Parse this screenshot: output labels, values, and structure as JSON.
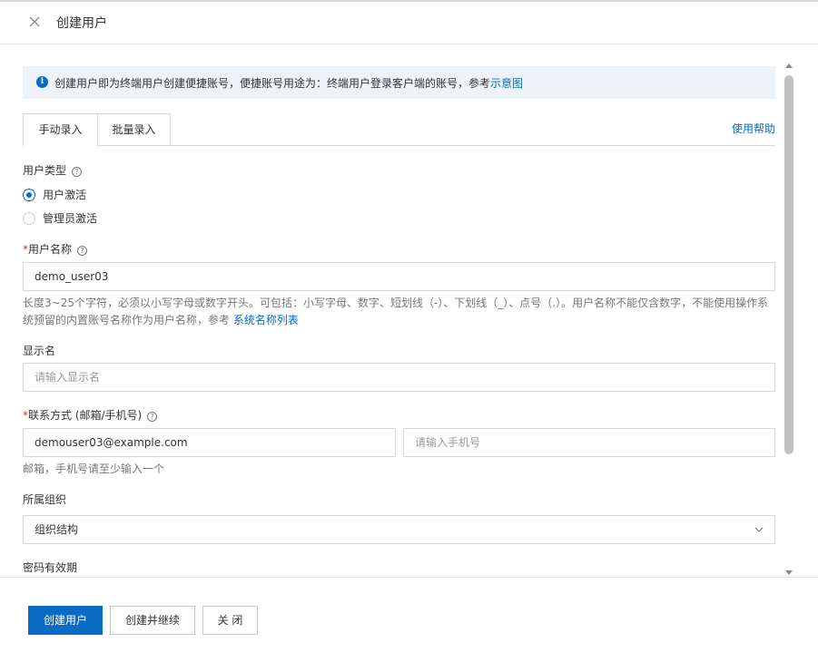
{
  "dialog": {
    "title": "创建用户"
  },
  "notice": {
    "text": "创建用户即为终端用户创建便捷账号，便捷账号用途为：终端用户登录客户端的账号，参考",
    "link": "示意图"
  },
  "tabs": [
    {
      "label": "手动录入"
    },
    {
      "label": "批量录入"
    }
  ],
  "help_link": "使用帮助",
  "user_type": {
    "label": "用户类型",
    "options": [
      {
        "label": "用户激活",
        "selected": true
      },
      {
        "label": "管理员激活",
        "selected": false
      }
    ]
  },
  "username": {
    "required_mark": "*",
    "label": "用户名称",
    "value": "demo_user03",
    "hint": "长度3~25个字符，必须以小写字母或数字开头。可包括：小写字母、数字、短划线（-）、下划线（_）、点号（.）。用户名称不能仅含数字，不能使用操作系统预留的内置账号名称作为用户名称，参考",
    "hint_link": "系统名称列表"
  },
  "display_name": {
    "label": "显示名",
    "placeholder": "请输入显示名"
  },
  "contact": {
    "required_mark": "*",
    "label": "联系方式 (邮箱/手机号)",
    "email_value": "demouser03@example.com",
    "phone_placeholder": "请输入手机号",
    "hint": "邮箱，手机号请至少输入一个"
  },
  "org": {
    "label": "所属组织",
    "value": "组织结构"
  },
  "password_expiry": {
    "label": "密码有效期"
  },
  "footer": {
    "create": "创建用户",
    "create_continue": "创建并继续",
    "close": "关 闭"
  },
  "colors": {
    "accent": "#0a6bc4",
    "notice_bg": "#eef3f9",
    "required": "#d93026"
  },
  "icons": {
    "close": "close-icon",
    "info": "info-icon",
    "help": "question-circle-icon",
    "dropdown": "chevron-down-icon"
  }
}
